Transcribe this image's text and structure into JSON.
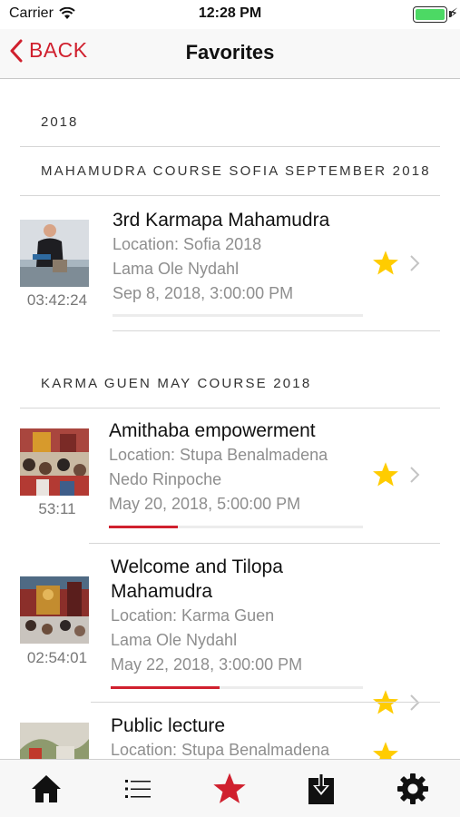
{
  "status_bar": {
    "carrier": "Carrier",
    "time": "12:28 PM"
  },
  "nav": {
    "back_label": "BACK",
    "title": "Favorites"
  },
  "year": "2018",
  "sections": [
    {
      "header": "MAHAMUDRA COURSE SOFIA SEPTEMBER 2018"
    },
    {
      "header": "KARMA GUEN MAY COURSE 2018"
    }
  ],
  "items": [
    {
      "title": "3rd Karmapa Mahamudra",
      "location": "Location: Sofia 2018",
      "teacher": "Lama Ole Nydahl",
      "date": "Sep 8, 2018, 3:00:00 PM",
      "duration": "03:42:24",
      "progress": 0.0,
      "favorite": true
    },
    {
      "title": "Amithaba empowerment",
      "location": "Location: Stupa Benalmadena",
      "teacher": "Nedo Rinpoche",
      "date": "May 20, 2018, 5:00:00 PM",
      "duration": "53:11",
      "progress": 0.27,
      "favorite": true
    },
    {
      "title_line1": "Welcome and Tilopa",
      "title_line2": "Mahamudra",
      "location": "Location: Karma Guen",
      "teacher": "Lama Ole Nydahl",
      "date": "May 22, 2018, 3:00:00 PM",
      "duration": "02:54:01",
      "progress": 0.43,
      "favorite": true
    },
    {
      "title": "Public lecture",
      "location": "Location: Stupa Benalmadena",
      "favorite": true
    }
  ],
  "tab_bar": {
    "tabs": [
      "home-icon",
      "list-icon",
      "star-icon",
      "download-icon",
      "settings-icon"
    ],
    "active": "star-icon"
  },
  "colors": {
    "accent": "#d0202e",
    "star": "#ffcc00",
    "meta_text": "#8e8e8e"
  }
}
